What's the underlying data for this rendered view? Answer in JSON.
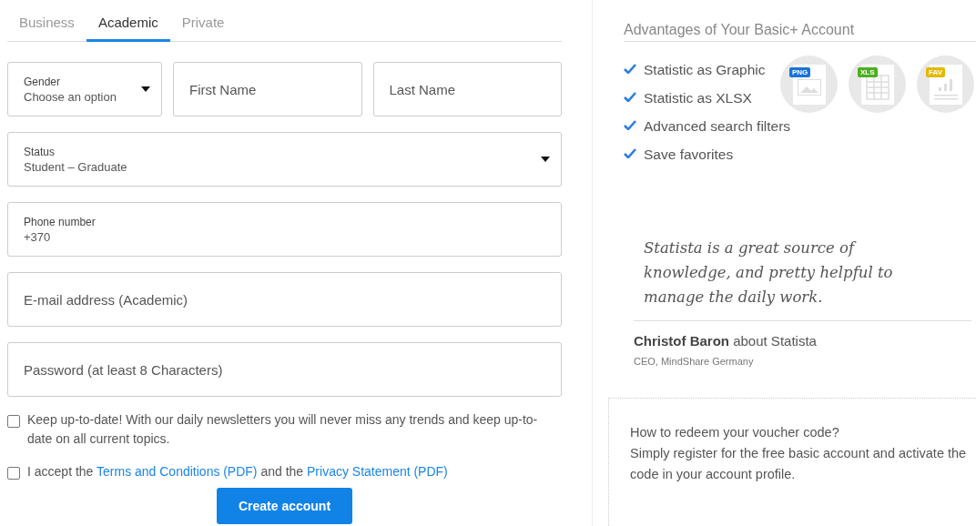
{
  "tabs": [
    {
      "label": "Business",
      "selected": false
    },
    {
      "label": "Academic",
      "selected": true
    },
    {
      "label": "Private",
      "selected": false
    }
  ],
  "form": {
    "gender": {
      "label": "Gender",
      "value": "Choose an option"
    },
    "first_name": {
      "placeholder": "First Name"
    },
    "last_name": {
      "placeholder": "Last Name"
    },
    "status": {
      "label": "Status",
      "value": "Student – Graduate"
    },
    "phone": {
      "label": "Phone number",
      "value": "+370"
    },
    "email": {
      "placeholder": "E-mail address (Academic)"
    },
    "password": {
      "placeholder": "Password (at least 8 Characters)"
    }
  },
  "checkboxes": [
    {
      "checked": false,
      "parts": [
        {
          "text": "Keep up-to-date! With our daily newsletters you will never miss any trends and keep up-to-date on all current topics.",
          "link": false
        }
      ]
    },
    {
      "checked": false,
      "parts": [
        {
          "text": "I accept the ",
          "link": false
        },
        {
          "text": "Terms and Conditions",
          "link": true
        },
        {
          "text": "(PDF)",
          "link": true
        },
        {
          "text": " and the ",
          "link": false
        },
        {
          "text": "Privacy Statement",
          "link": true
        },
        {
          "text": "(PDF)",
          "link": true
        }
      ]
    }
  ],
  "submit": "Create account",
  "advantages": {
    "title": "Advantages of Your Basic+ Account",
    "items": [
      "Statistic as Graphic",
      "Statistic as XLSX",
      "Advanced search filters",
      "Save favorites"
    ],
    "badges": [
      {
        "label": "PNG",
        "kind": "image",
        "color": "#1a73d9"
      },
      {
        "label": "XLS",
        "kind": "table",
        "color": "#4caf1f"
      },
      {
        "label": "FAV",
        "kind": "chart",
        "color": "#e6b800"
      }
    ]
  },
  "quote": {
    "text": "Statista is a great source of knowledge, and pretty helpful to manage the daily work.",
    "author": "Christof Baron",
    "about": "about Statista",
    "role": "CEO, MindShare Germany"
  },
  "voucher": {
    "lines": [
      "How to redeem your voucher code?",
      "Simply register for the free basic account and activate the code in your account profile."
    ]
  }
}
